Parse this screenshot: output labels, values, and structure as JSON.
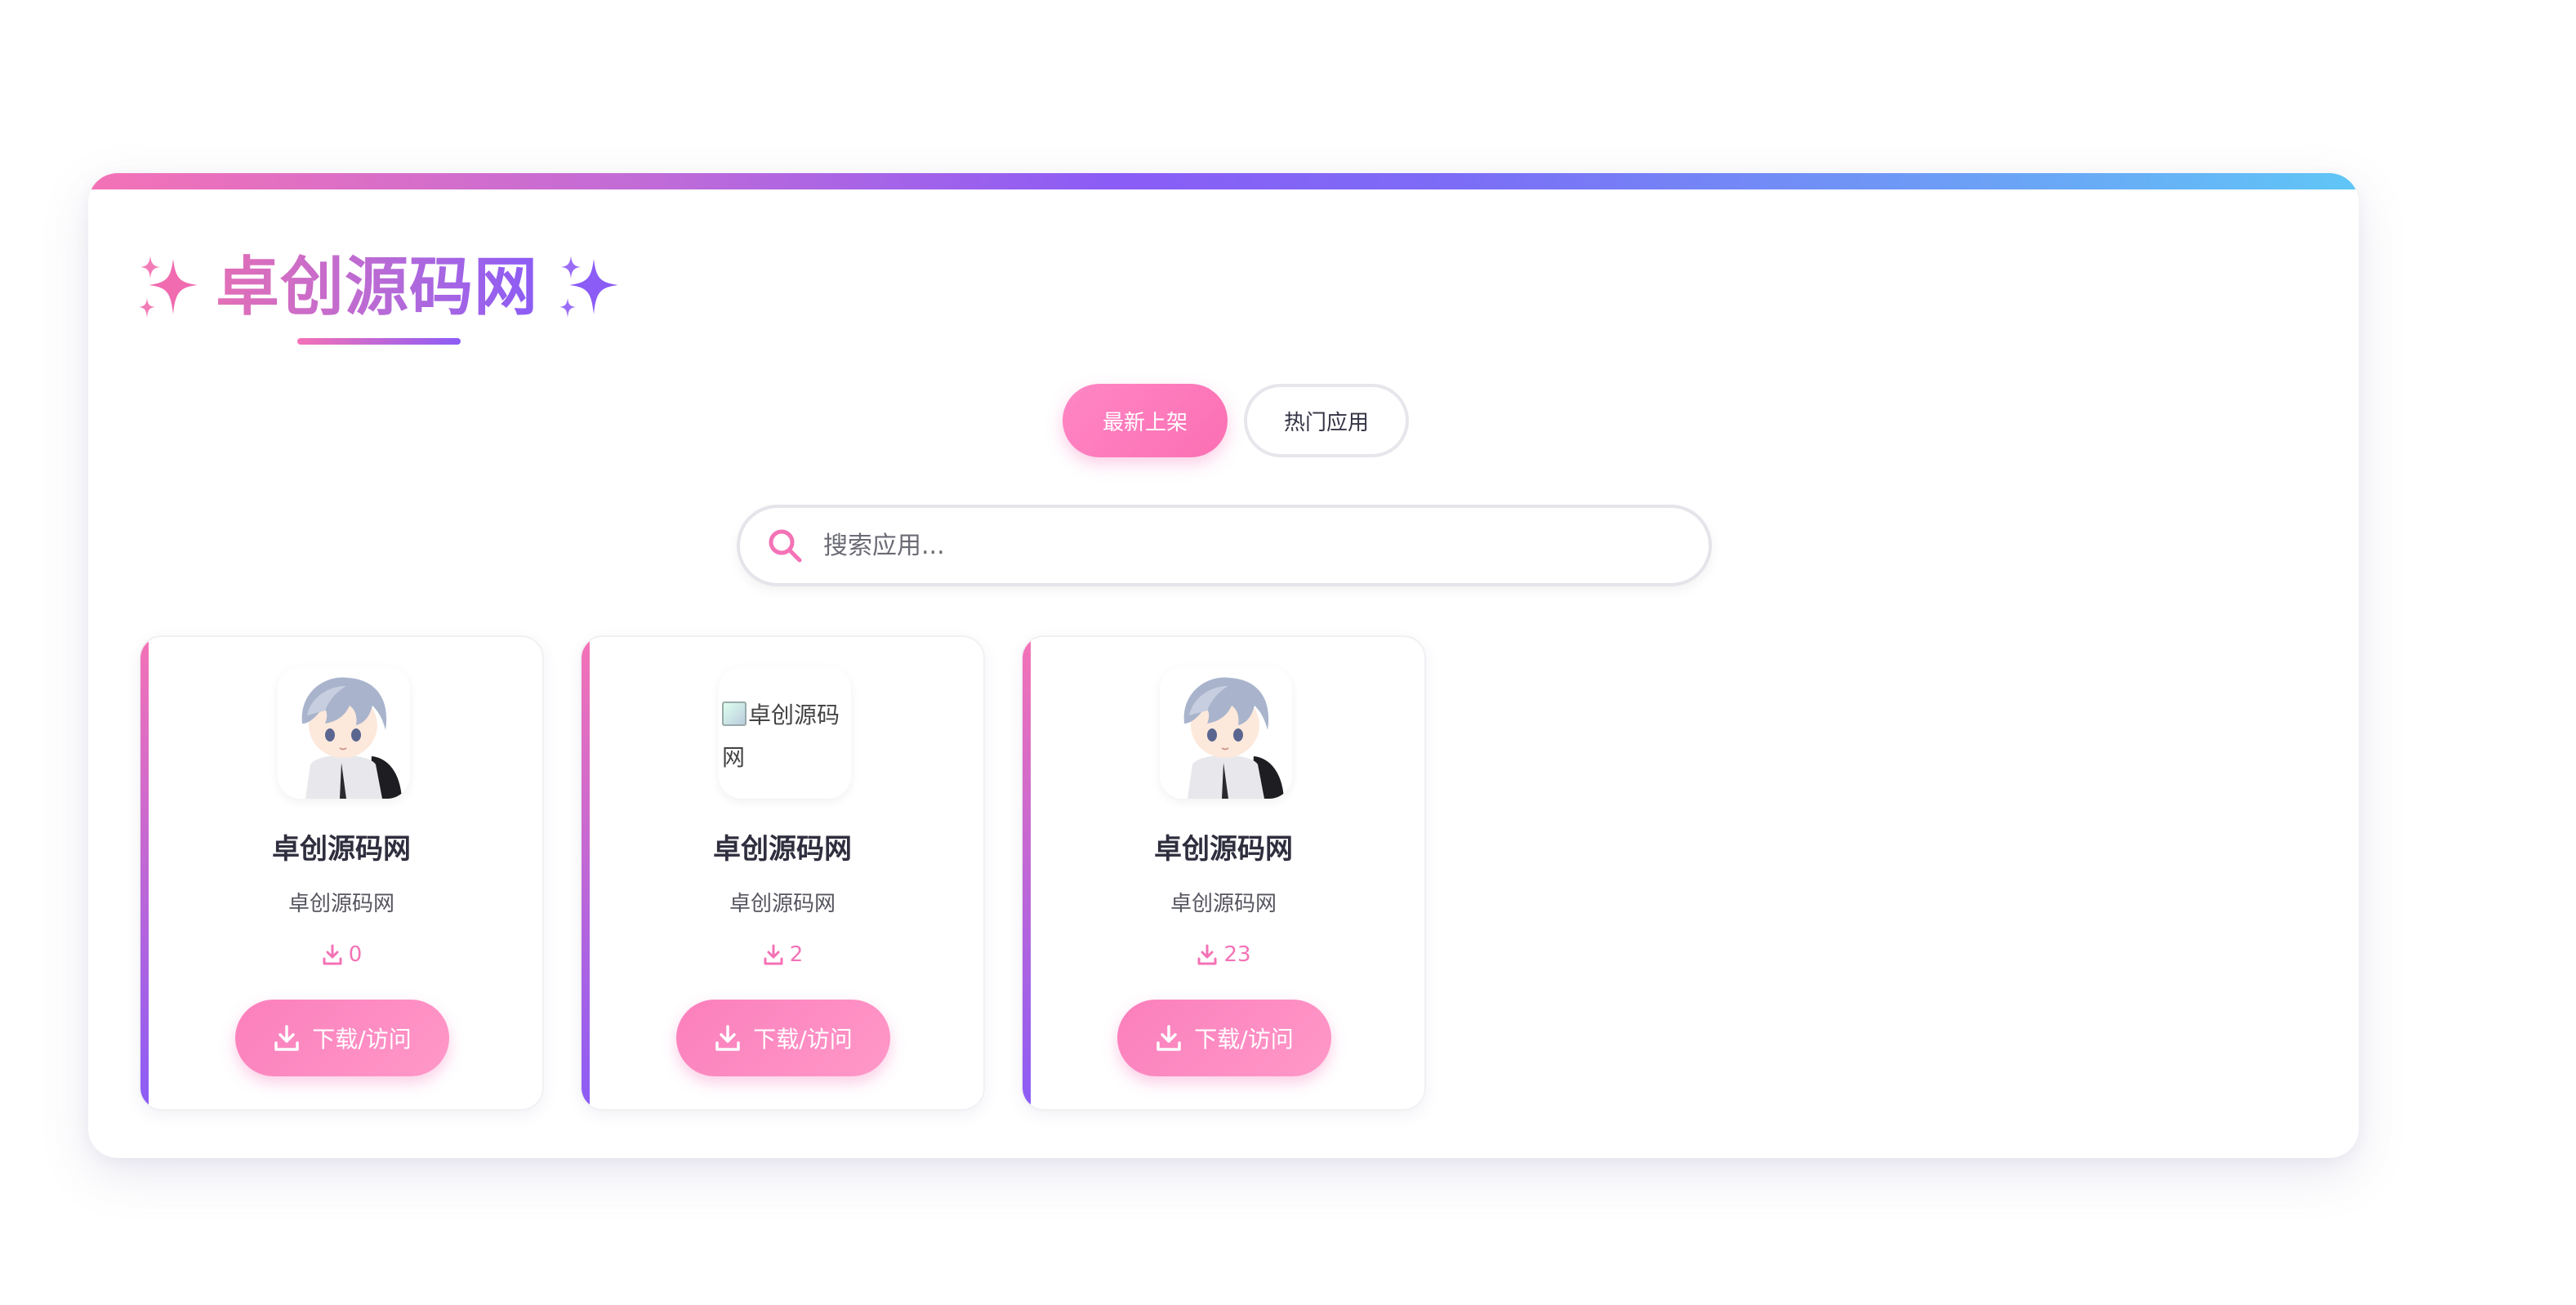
{
  "site": {
    "title": "卓创源码网"
  },
  "tabs": [
    {
      "label": "最新上架",
      "active": true
    },
    {
      "label": "热门应用",
      "active": false
    }
  ],
  "search": {
    "placeholder": "搜索应用..."
  },
  "cards": [
    {
      "name": "卓创源码网",
      "description": "卓创源码网",
      "downloads": "0",
      "button_label": "下载/访问",
      "icon": "anime-avatar-image"
    },
    {
      "name": "卓创源码网",
      "description": "卓创源码网",
      "downloads": "2",
      "button_label": "下载/访问",
      "icon": "broken-image",
      "icon_alt": "卓创源码网"
    },
    {
      "name": "卓创源码网",
      "description": "卓创源码网",
      "downloads": "23",
      "button_label": "下载/访问",
      "icon": "anime-avatar-image"
    }
  ],
  "colors": {
    "accent_pink": "#f472b6",
    "accent_purple": "#8b5cf6",
    "accent_blue": "#60c6f6"
  }
}
